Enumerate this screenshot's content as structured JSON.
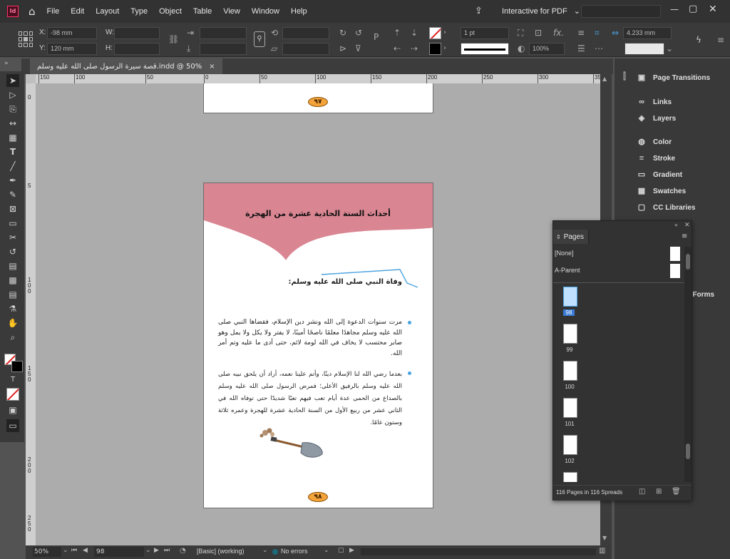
{
  "menubar": {
    "app_icon": "Id",
    "items": [
      "File",
      "Edit",
      "Layout",
      "Type",
      "Object",
      "Table",
      "View",
      "Window",
      "Help"
    ],
    "workspace": "Interactive for PDF"
  },
  "control": {
    "x_label": "X:",
    "x_value": "-98 mm",
    "y_label": "Y:",
    "y_value": "120 mm",
    "w_label": "W:",
    "h_label": "H:",
    "stroke_weight": "1 pt",
    "zoom_pct": "100%",
    "gutter": "4.233 mm",
    "fx_label": "fx."
  },
  "tab": {
    "title": "قصة سيرة الرسول صلى الله عليه وسلم.indd @ 50%",
    "close": "×"
  },
  "ruler": {
    "h_ticks": [
      "150",
      "100",
      "50",
      "0",
      "50",
      "100",
      "150",
      "200",
      "250",
      "300",
      "350"
    ],
    "v_ticks": [
      "0",
      "5",
      "1 0 0",
      "1 5 0",
      "2 0 0",
      "2 5 0"
    ]
  },
  "canvas": {
    "page97": {
      "number": "٩٧"
    },
    "page98": {
      "heading": "أحداث السنة الحادية عشرة من الهجرة",
      "subheading": "وفاة النبي صلى الله عليه وسلم:",
      "para1": "مرت سنوات الدعوة إلى الله ونشر دين الإسلام، فقضاها النبي صلى الله عليه وسلم مجاهدًا معلمًا ناصحًا أمينًا، لا يفتر ولا يكل ولا يمل وهو صابر محتسب لا يخاف في الله لومة لائم، حتى أدى ما عليه وتم أمر الله.",
      "para2": "بعدما رضي الله لنا الإسلام دينًا، وأتم علينا نعمه، أراد أن يلحق نبيه صلى الله عليه وسلم بالرفيق الأعلى؛ فمرض الرسول صلى الله عليه وسلم بالصداع من الحمى عدة أيام تعب فيهم تعبًا شديدًا حتى توفاه الله في الثاني عشر من ربيع الأول من السنة الحادية عشرة للهجرة وعمره ثلاثة وستون عامًا.",
      "number": "٩٨"
    }
  },
  "status": {
    "zoom": "50%",
    "page": "98",
    "master": "[Basic] (working)",
    "errors": "No errors"
  },
  "dock": {
    "items": [
      "Page Transitions",
      "Links",
      "Layers",
      "Color",
      "Stroke",
      "Gradient",
      "Swatches",
      "CC Libraries"
    ],
    "forms_partial": "l Forms"
  },
  "pages_panel": {
    "title": "Pages",
    "parents": [
      "[None]",
      "A-Parent"
    ],
    "pages": [
      "98",
      "99",
      "100",
      "101",
      "102"
    ],
    "footer": "116 Pages in 116 Spreads"
  },
  "colors": {
    "accent": "#4aa3df",
    "header_pink": "#d98592",
    "badge": "#f3a33a",
    "bg": "#535353"
  }
}
